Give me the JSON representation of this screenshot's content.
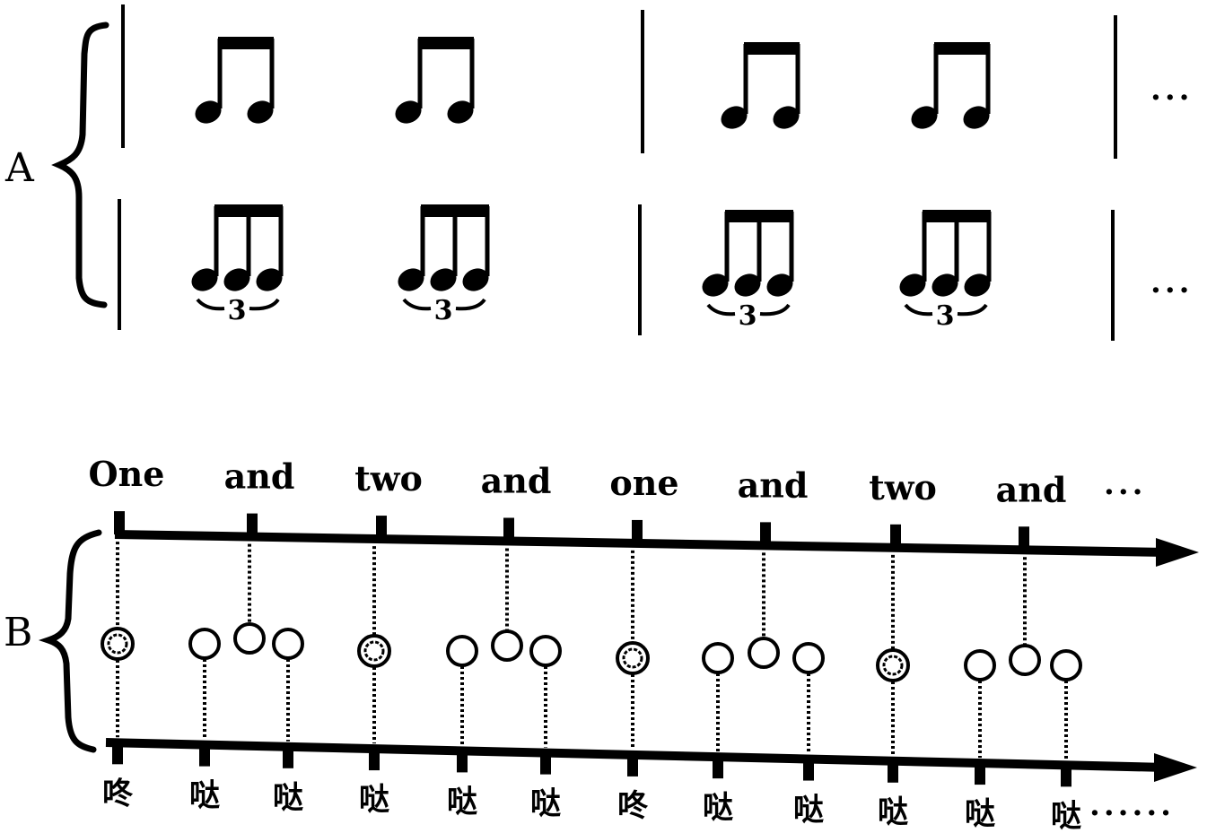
{
  "section_a": {
    "label": "A",
    "rows": [
      {
        "name": "eighth-note-pairs",
        "description": "two beamed eighth notes per beat",
        "measures": [
          {
            "beats": [
              {
                "notes": 2
              },
              {
                "notes": 2
              }
            ]
          },
          {
            "beats": [
              {
                "notes": 2
              },
              {
                "notes": 2
              }
            ]
          }
        ],
        "continuation": "···"
      },
      {
        "name": "eighth-note-triplets",
        "description": "three beamed eighth notes per beat (triplet)",
        "measures": [
          {
            "beats": [
              {
                "notes": 3,
                "tuplet": "3"
              },
              {
                "notes": 3,
                "tuplet": "3"
              }
            ]
          },
          {
            "beats": [
              {
                "notes": 3,
                "tuplet": "3"
              },
              {
                "notes": 3,
                "tuplet": "3"
              }
            ]
          }
        ],
        "continuation": "···"
      }
    ]
  },
  "section_b": {
    "label": "B",
    "top_axis": {
      "counts": [
        "One",
        "and",
        "two",
        "and",
        "one",
        "and",
        "two",
        "and"
      ],
      "continuation": "···"
    },
    "pulse_groups": [
      {
        "downbeat": "double-circle",
        "subdivisions": [
          "bottom",
          "top",
          "bottom"
        ]
      },
      {
        "downbeat": "double-circle",
        "subdivisions": [
          "bottom",
          "top",
          "bottom"
        ]
      },
      {
        "downbeat": "double-circle",
        "subdivisions": [
          "bottom",
          "top",
          "bottom"
        ]
      },
      {
        "downbeat": "double-circle",
        "subdivisions": [
          "bottom",
          "top",
          "bottom"
        ]
      }
    ],
    "bottom_axis": {
      "syllables": [
        "咚",
        "哒",
        "哒",
        "哒",
        "哒",
        "哒",
        "咚",
        "哒",
        "哒",
        "哒",
        "哒",
        "哒"
      ],
      "continuation": "······"
    }
  }
}
